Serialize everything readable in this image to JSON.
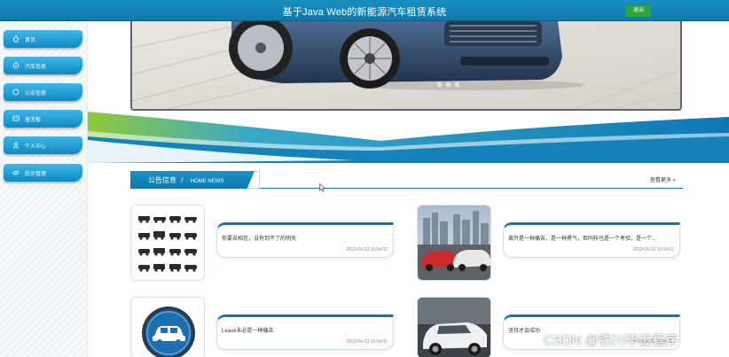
{
  "header": {
    "title": "基于Java Web的新能源汽车租赁系统",
    "logout_label": "退出"
  },
  "sidebar": {
    "items": [
      {
        "label": "首页",
        "icon": "home-icon"
      },
      {
        "label": "汽车信息",
        "icon": "car-info-icon"
      },
      {
        "label": "公告信息",
        "icon": "notice-icon"
      },
      {
        "label": "留言板",
        "icon": "message-icon"
      },
      {
        "label": "个人中心",
        "icon": "user-icon"
      },
      {
        "label": "后台管理",
        "icon": "link-icon"
      }
    ]
  },
  "banner": {
    "slide_count": 3
  },
  "news": {
    "title_cn": "公告信息",
    "separator": "/",
    "title_en": "HOME NEWS",
    "more_label": "查看更多",
    "items": [
      {
        "text": "你要去相信，没有到不了的明天",
        "date": "2023-04-23 10:04:01"
      },
      {
        "text": "离开是一种痛苦，是一种勇气，但同样也是一个考验，是一个...",
        "date": "2023-04-23 10:04:01"
      },
      {
        "text": "Leave未必是一种痛苦",
        "date": "2023-04-23 10:04:01"
      },
      {
        "text": "坚持才会成功",
        "date": "2023-04-23 10:04:01"
      }
    ]
  },
  "watermark": "CSDN @铁川毕设程序",
  "colors": {
    "primary": "#0f79ab",
    "accent_green": "#2fa541",
    "nav_light": "#3fb6e6"
  }
}
